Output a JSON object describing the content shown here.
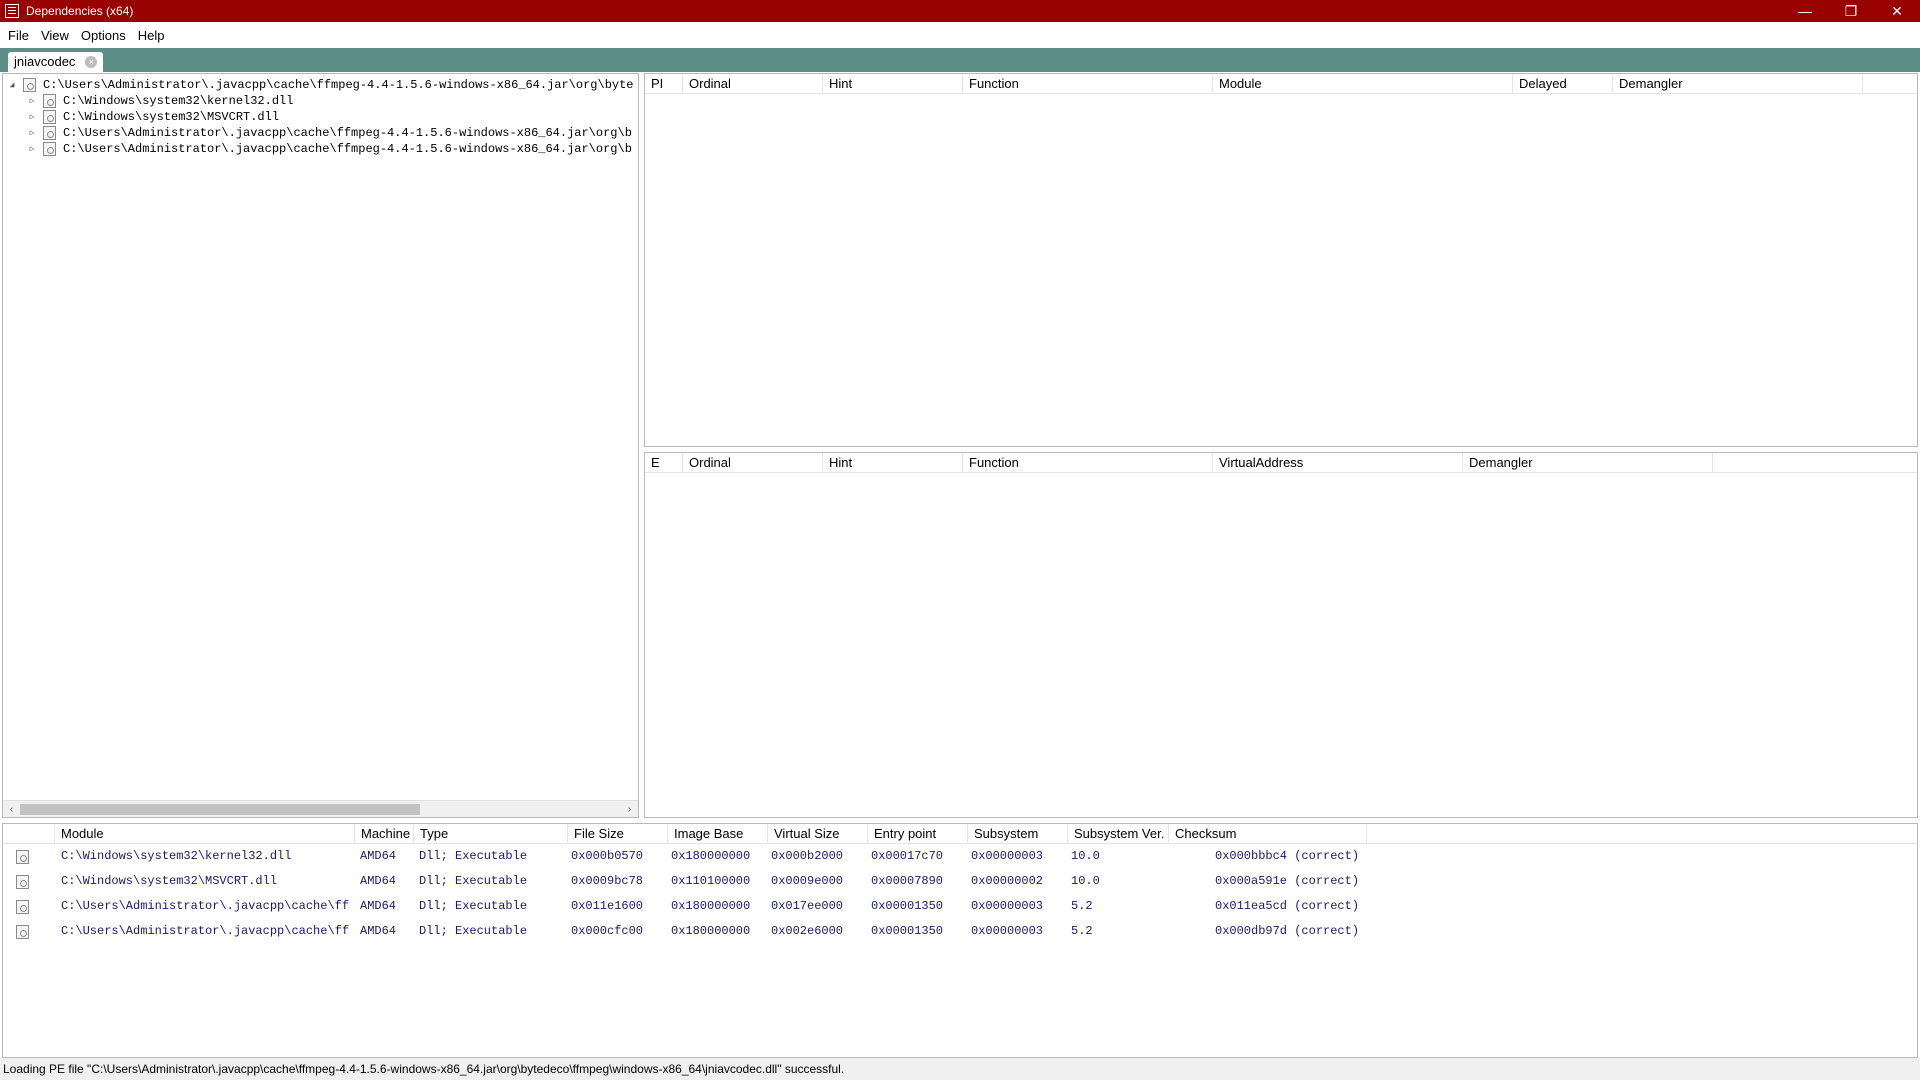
{
  "window": {
    "title": "Dependencies (x64)",
    "controls": {
      "minimize": "—",
      "maximize": "❐",
      "close": "✕"
    }
  },
  "menu": [
    {
      "label": "File"
    },
    {
      "label": "View"
    },
    {
      "label": "Options"
    },
    {
      "label": "Help"
    }
  ],
  "tab": {
    "label": "jniavcodec",
    "close": "×"
  },
  "tree": {
    "root": {
      "label": "C:\\Users\\Administrator\\.javacpp\\cache\\ffmpeg-4.4-1.5.6-windows-x86_64.jar\\org\\byte",
      "toggle": "◢"
    },
    "children": [
      {
        "label": "C:\\Windows\\system32\\kernel32.dll",
        "toggle": "▷"
      },
      {
        "label": "C:\\Windows\\system32\\MSVCRT.dll",
        "toggle": "▷"
      },
      {
        "label": "C:\\Users\\Administrator\\.javacpp\\cache\\ffmpeg-4.4-1.5.6-windows-x86_64.jar\\org\\b",
        "toggle": "▷"
      },
      {
        "label": "C:\\Users\\Administrator\\.javacpp\\cache\\ffmpeg-4.4-1.5.6-windows-x86_64.jar\\org\\b",
        "toggle": "▷"
      }
    ],
    "scroll_left": "‹",
    "scroll_right": "›"
  },
  "imports": {
    "columns": [
      "PI",
      "Ordinal",
      "Hint",
      "Function",
      "Module",
      "Delayed",
      "Demangler"
    ]
  },
  "exports": {
    "columns": [
      "E",
      "Ordinal",
      "Hint",
      "Function",
      "VirtualAddress",
      "Demangler"
    ]
  },
  "modules": {
    "columns": [
      "Module",
      "Machine",
      "Type",
      "File Size",
      "Image Base",
      "Virtual Size",
      "Entry point",
      "Subsystem",
      "Subsystem Ver.",
      "Checksum"
    ],
    "rows": [
      [
        "C:\\Windows\\system32\\kernel32.dll",
        "AMD64",
        "Dll; Executable",
        "0x000b0570",
        "0x180000000",
        "0x000b2000",
        "0x00017c70",
        "0x00000003",
        "10.0",
        "0x000bbbc4 (correct)"
      ],
      [
        "C:\\Windows\\system32\\MSVCRT.dll",
        "AMD64",
        "Dll; Executable",
        "0x0009bc78",
        "0x110100000",
        "0x0009e000",
        "0x00007890",
        "0x00000002",
        "10.0",
        "0x000a591e (correct)"
      ],
      [
        "C:\\Users\\Administrator\\.javacpp\\cache\\ff",
        "AMD64",
        "Dll; Executable",
        "0x011e1600",
        "0x180000000",
        "0x017ee000",
        "0x00001350",
        "0x00000003",
        "5.2",
        "0x011ea5cd (correct)"
      ],
      [
        "C:\\Users\\Administrator\\.javacpp\\cache\\ff",
        "AMD64",
        "Dll; Executable",
        "0x000cfc00",
        "0x180000000",
        "0x002e6000",
        "0x00001350",
        "0x00000003",
        "5.2",
        "0x000db97d (correct)"
      ]
    ]
  },
  "status": "Loading PE file \"C:\\Users\\Administrator\\.javacpp\\cache\\ffmpeg-4.4-1.5.6-windows-x86_64.jar\\org\\bytedeco\\ffmpeg\\windows-x86_64\\jniavcodec.dll\" successful."
}
